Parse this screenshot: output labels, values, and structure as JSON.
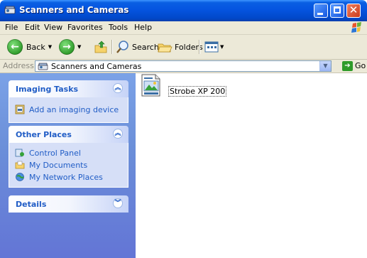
{
  "window": {
    "title": "Scanners and Cameras"
  },
  "menu": {
    "items": [
      "File",
      "Edit",
      "View",
      "Favorites",
      "Tools",
      "Help"
    ]
  },
  "toolbar": {
    "back_label": "Back",
    "search_label": "Search",
    "folders_label": "Folders"
  },
  "address": {
    "label": "Address",
    "value": "Scanners and Cameras",
    "go_label": "Go"
  },
  "taskpane": {
    "imaging": {
      "title": "Imaging Tasks",
      "items": [
        "Add an imaging device"
      ]
    },
    "other": {
      "title": "Other Places",
      "items": [
        "Control Panel",
        "My Documents",
        "My Network Places"
      ]
    },
    "details": {
      "title": "Details"
    }
  },
  "content": {
    "items": [
      {
        "label": "Strobe XP 200",
        "icon": "scanner-device-icon"
      }
    ]
  },
  "colors": {
    "titlebar": "#0554e0",
    "taskpane_bg": "#6b8fd9",
    "task_link": "#215dc6",
    "chrome": "#ece9d8"
  }
}
